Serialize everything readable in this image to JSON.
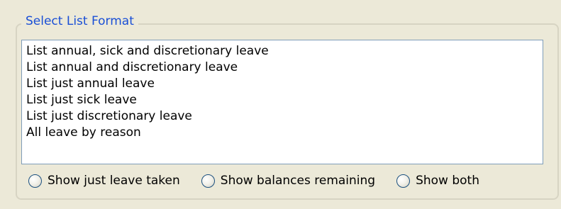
{
  "group": {
    "title": "Select List Format"
  },
  "list": {
    "items": [
      "List annual, sick and discretionary leave",
      "List annual and discretionary leave",
      "List just annual leave",
      "List just sick leave",
      "List just discretionary leave",
      "All leave by reason"
    ]
  },
  "options": {
    "taken": "Show just leave taken",
    "balances": "Show balances remaining",
    "both": "Show both"
  },
  "colors": {
    "background": "#ece9d8",
    "group_title": "#1a4fd6",
    "listbox_border": "#7f9db9",
    "radio_border": "#1c5180"
  }
}
